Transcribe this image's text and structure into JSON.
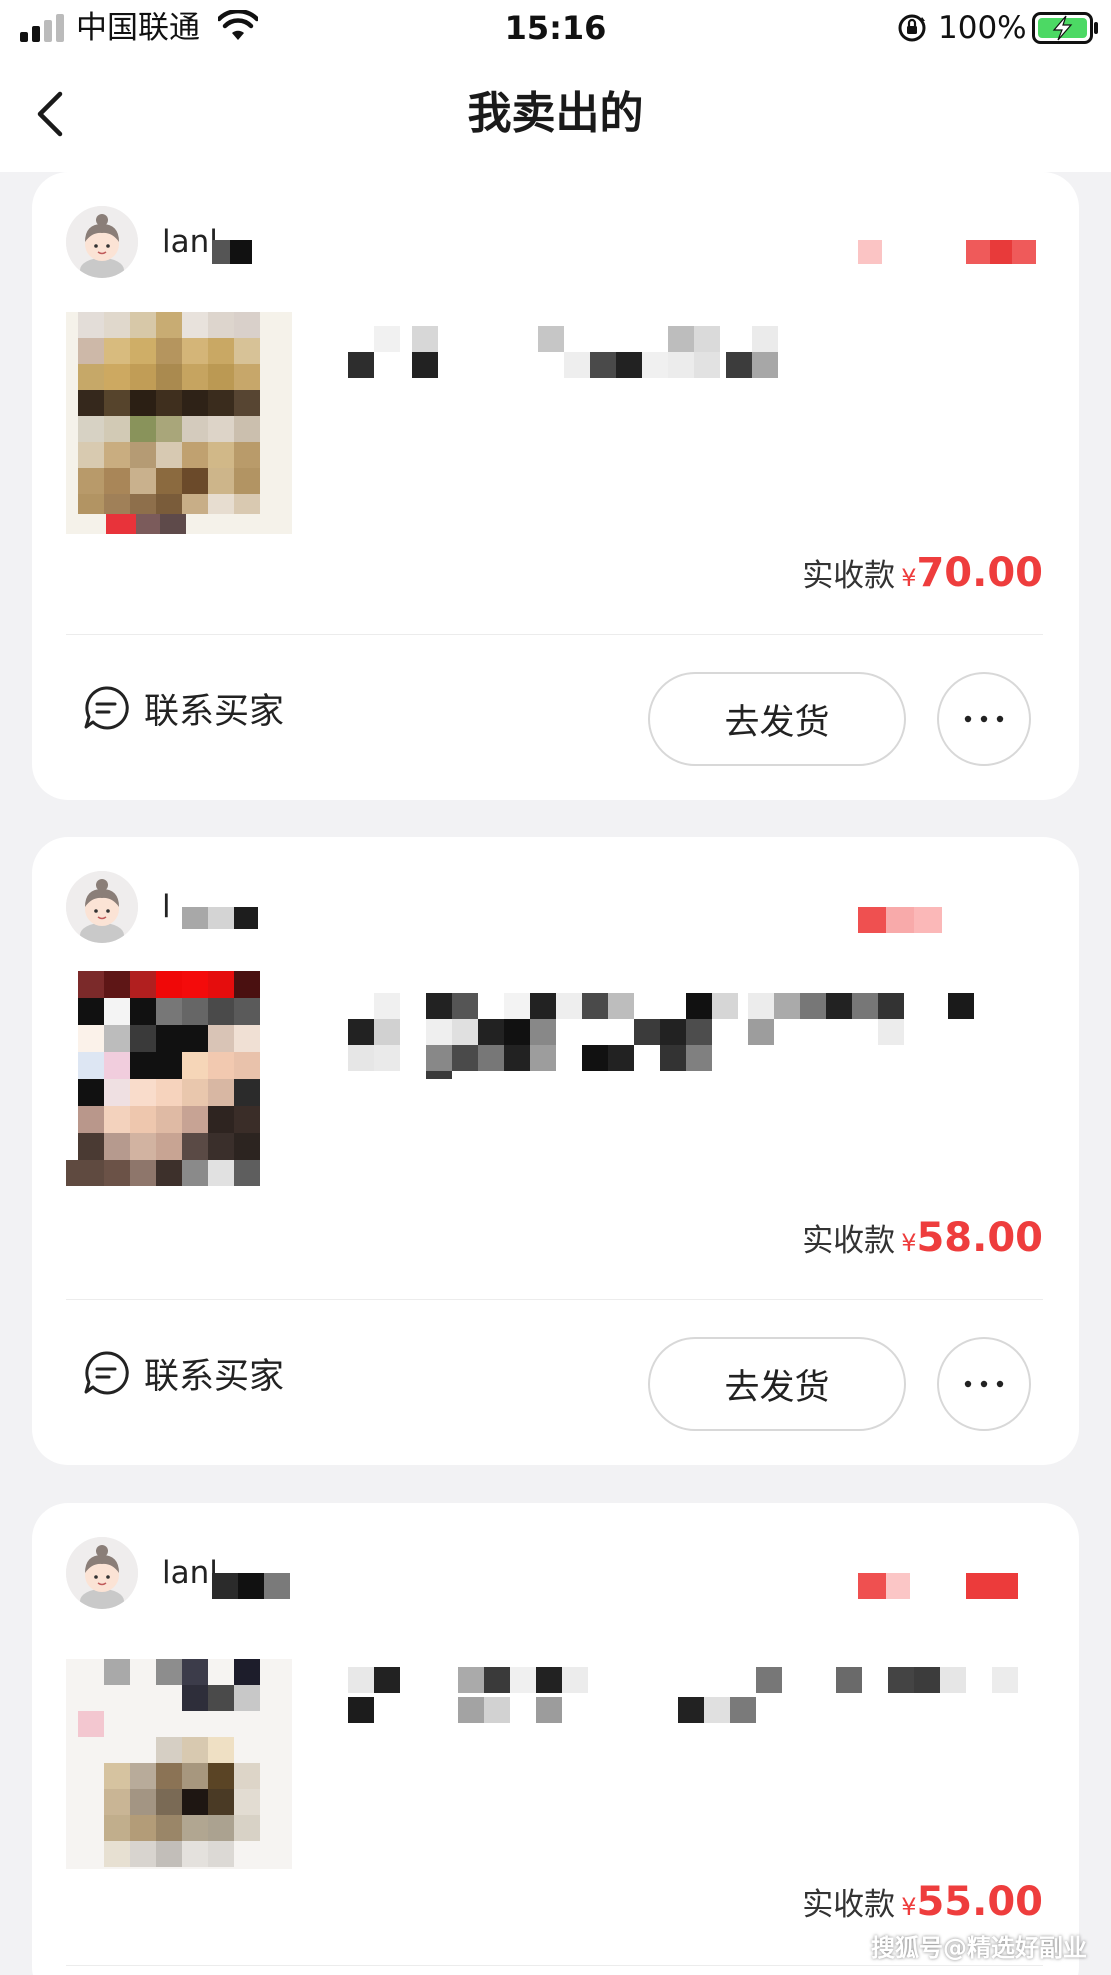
{
  "status_bar": {
    "carrier": "中国联通",
    "time": "15:16",
    "battery_percent": "100%",
    "signal_icon": "signal-icon",
    "wifi_icon": "wifi-icon",
    "lock_icon": "orientation-lock-icon",
    "battery_icon": "battery-charging-icon"
  },
  "nav": {
    "title": "我卖出的",
    "back_icon": "chevron-left-icon"
  },
  "orders": [
    {
      "buyer_name": "lanl",
      "price_label": "实收款",
      "currency": "¥",
      "price": "70.00",
      "contact_label": "联系买家",
      "ship_label": "去发货",
      "more_icon": "ellipsis-icon"
    },
    {
      "buyer_name": "l",
      "price_label": "实收款",
      "currency": "¥",
      "price": "58.00",
      "contact_label": "联系买家",
      "ship_label": "去发货",
      "more_icon": "ellipsis-icon"
    },
    {
      "buyer_name": "lanl",
      "price_label": "实收款",
      "currency": "¥",
      "price": "55.00"
    }
  ],
  "watermark": "搜狐号@精选好副业",
  "colors": {
    "accent_red": "#ee3d3d",
    "background": "#f2f2f4",
    "card": "#ffffff",
    "battery_green": "#4cd964"
  }
}
